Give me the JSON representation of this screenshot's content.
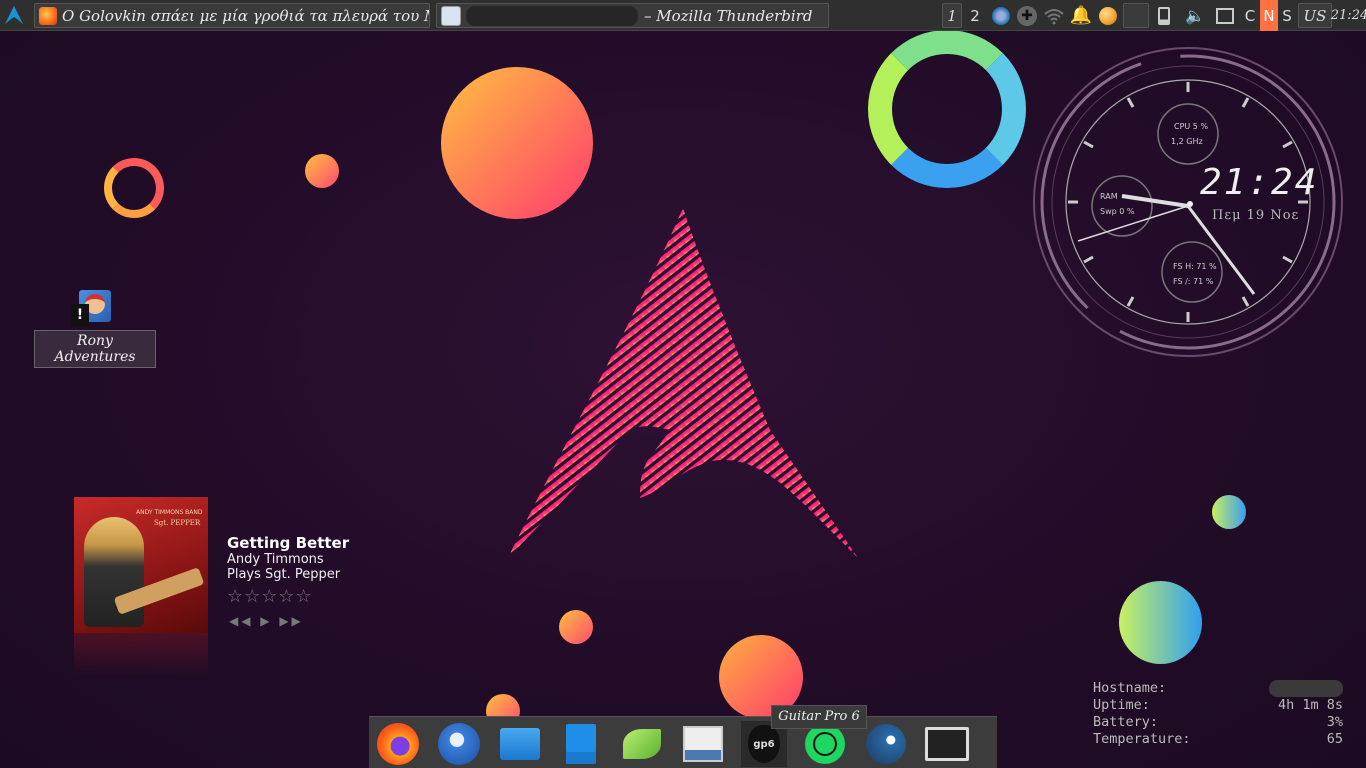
{
  "panel": {
    "task1_title": "Ο Golovkin σπάει με μία γροθιά τα πλευρά του M...",
    "task2_title": "– Mozilla Thunderbird",
    "workspaces": [
      "1",
      "2"
    ],
    "keyboard_indicators": [
      "C",
      "N",
      "S"
    ],
    "layout": "US",
    "clock": "21:24"
  },
  "desktop_icon": {
    "label": "Rony Adventures"
  },
  "music": {
    "title": "Getting Better",
    "artist": "Andy Timmons",
    "album": "Plays Sgt. Pepper",
    "stars": "☆☆☆☆☆",
    "controls": "◀◀ ▶ ▶▶",
    "cover_text_band": "ANDY TIMMONS BAND",
    "cover_text_album": "Sgt. PEPPER"
  },
  "clock_widget": {
    "time": "21:24",
    "date": "Πεμ 19 Νοε",
    "cpu": "CPU 5 %",
    "freq": "1,2 GHz",
    "ram": "RAM",
    "swap": "Swp 0 %",
    "fs_home": "FS H: 71 %",
    "fs_root": "FS /: 71 %"
  },
  "sysinfo": {
    "hostname_label": "Hostname:",
    "uptime_label": "Uptime:",
    "uptime_value": "4h 1m 8s",
    "battery_label": "Battery:",
    "battery_value": "3%",
    "temperature_label": "Temperature:",
    "temperature_value": "65"
  },
  "dock": {
    "tooltip": "Guitar Pro 6",
    "gp_label": "gp6"
  },
  "colors": {
    "accent_orange": "#ffb347",
    "accent_pink": "#ff3c78",
    "panel_bg": "#2f2f2f",
    "highlight": "#ff7043"
  }
}
